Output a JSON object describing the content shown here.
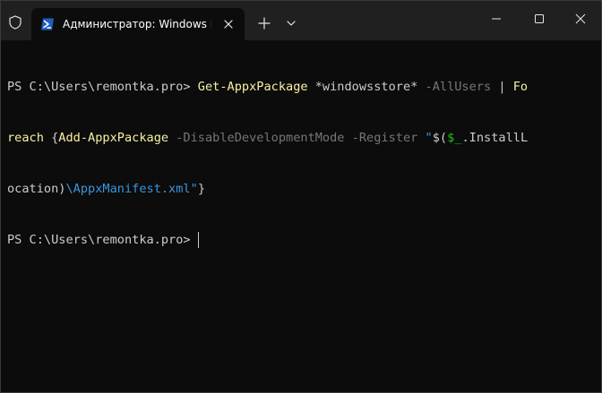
{
  "titlebar": {
    "tab_title": "Администратор: Windows PowerShell",
    "tab_icon": "powershell-icon",
    "new_tab_icon": "plus-icon",
    "dropdown_icon": "chevron-down-icon",
    "window_buttons": [
      "minimize-icon",
      "maximize-icon",
      "close-icon"
    ]
  },
  "terminal": {
    "line1": {
      "prompt": "PS C:\\Users\\remontka.pro> ",
      "cmd1": "Get-AppxPackage",
      "arg1": " *windowsstore* ",
      "param1": "-AllUsers",
      "pipe": " | ",
      "cmd2a": "Fo"
    },
    "line2": {
      "cmd2b": "reach",
      "brace_open": " {",
      "cmd3": "Add-AppxPackage",
      "space1": " ",
      "param2": "-DisableDevelopmentMode",
      "space2": " ",
      "param3": "-Register",
      "space3": " ",
      "str1": "\"",
      "subexpr_open": "$(",
      "var": "$_",
      "prop": ".InstallL"
    },
    "line3": {
      "prop_cont": "ocation",
      "subexpr_close": ")",
      "str2": "\\AppxManifest.xml\"",
      "brace_close": "}"
    },
    "line4": {
      "prompt": "PS C:\\Users\\remontka.pro>"
    }
  },
  "colors": {
    "background": "#0c0c0c",
    "titlebar": "#202020",
    "command": "#f9f1a5",
    "parameter": "#767676",
    "string": "#3a96dd",
    "variable": "#16c60c",
    "default_text": "#cccccc"
  }
}
